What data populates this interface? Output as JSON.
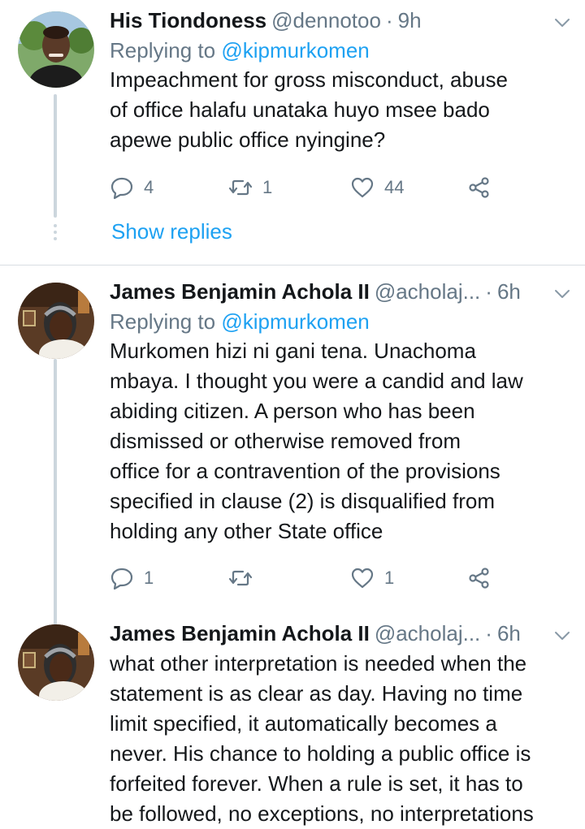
{
  "tweets": [
    {
      "name": "His Tiondoness",
      "handle": "@dennotoo",
      "separator": "·",
      "time": "9h",
      "replying_prefix": "Replying to",
      "replying_to": "@kipmurkomen",
      "lines": [
        "Impeachment for gross misconduct, abuse",
        "of office halafu unataka huyo msee bado",
        "apewe public office nyingine?"
      ],
      "replies": "4",
      "retweets": "1",
      "likes": "44",
      "show_replies": "Show replies"
    },
    {
      "name": "James Benjamin Achola II",
      "handle": "@acholaj...",
      "separator": "·",
      "time": "6h",
      "replying_prefix": "Replying to",
      "replying_to": "@kipmurkomen",
      "lines": [
        "Murkomen hizi ni gani tena. Unachoma",
        "mbaya. I thought you were a candid and law",
        "abiding citizen. A person who has been",
        "dismissed or otherwise removed from",
        "office for a contravention of the provisions",
        "specified in clause (2) is disqualified from",
        "holding any other State office"
      ],
      "replies": "1",
      "retweets": "",
      "likes": "1"
    },
    {
      "name": "James Benjamin Achola II",
      "handle": "@acholaj...",
      "separator": "·",
      "time": "6h",
      "lines": [
        "what other interpretation is needed when the",
        "statement is as clear as day. Having no time",
        "limit specified, it automatically becomes a",
        "never. His chance to holding a public office is",
        "forfeited forever. When a rule is set, it has to",
        "be followed, no exceptions, no interpretations"
      ]
    }
  ],
  "colors": {
    "accent": "#1da1f2",
    "muted": "#657786",
    "text": "#14171a",
    "thread_line": "#ccd6dd"
  },
  "icons": [
    "reply-icon",
    "retweet-icon",
    "like-icon",
    "share-icon",
    "chevron-down-icon"
  ]
}
